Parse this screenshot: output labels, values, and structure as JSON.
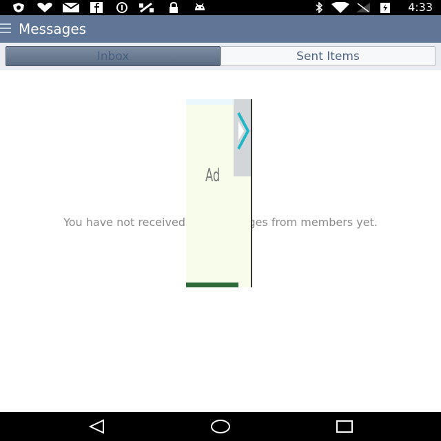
{
  "status_bar": {
    "time": "4:33",
    "left_icons": [
      "shield-icon",
      "heart-icon",
      "mail-icon",
      "facebook-icon",
      "alert-icon",
      "satellite-icon",
      "lock-icon",
      "android-icon"
    ],
    "right_icons": [
      "bluetooth-icon",
      "wifi-icon",
      "no-signal-icon",
      "battery-charging-icon"
    ]
  },
  "app_bar": {
    "title": "Messages",
    "menu_icon": "hamburger-menu-icon"
  },
  "tabs": [
    {
      "label": "Inbox",
      "selected": true
    },
    {
      "label": "Sent Items",
      "selected": false
    }
  ],
  "main": {
    "empty_message": "You have not received any messages from members yet."
  },
  "ad": {
    "label": "Ad",
    "icon": "play-icon"
  },
  "nav_bar": {
    "buttons": [
      "back-icon",
      "home-icon",
      "recents-icon"
    ]
  },
  "colors": {
    "app_bar": "#5f7696",
    "tab_selected": "#6a7d95",
    "text_muted": "#8a8a8a"
  }
}
